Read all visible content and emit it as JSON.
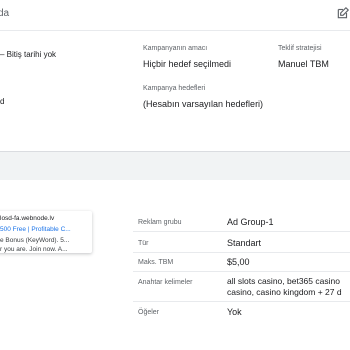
{
  "header": {
    "title_fragment": "da",
    "edit_icon": "pencil-square-icon"
  },
  "campaign": {
    "dates_fragment": "– Bitiş tarihi yok",
    "status_fragment": "d",
    "goal_label": "Kampanyanın amacı",
    "goal_value": "Hiçbir hedef seçilmedi",
    "bid_strategy_label": "Teklif stratejisi",
    "bid_strategy_value": "Manuel TBM",
    "objectives_label": "Kampanya hedefleri",
    "objectives_value": "(Hesabın varsayılan hedefleri)"
  },
  "ad_preview": {
    "url": "losd-fa.webnode.lv",
    "headline": "500 Free | Profitable C...",
    "desc1": "e Bonus (KeyWord). 5...",
    "desc2": "r you are. Join now. A..."
  },
  "ad_group_details": {
    "ad_group_label": "Reklam grubu",
    "ad_group_value": "Ad Group-1",
    "type_label": "Tür",
    "type_value": "Standart",
    "max_cpc_label": "Maks. TBM",
    "max_cpc_value": "$5,00",
    "keywords_label": "Anahtar kelimeler",
    "keywords_line1": "all slots casino, bet365 casino",
    "keywords_line2": "casino, casino kingdom + 27 d",
    "assets_label": "Öğeler",
    "assets_value": "Yok"
  }
}
